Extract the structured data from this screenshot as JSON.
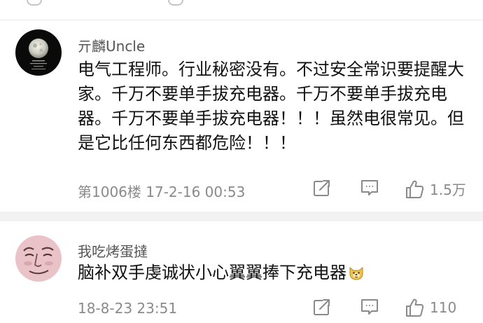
{
  "comments": [
    {
      "username": "亓麟Uncle",
      "text": "电气工程师。行业秘密没有。不过安全常识要提醒大家。千万不要单手拔充电器。千万不要单手拔充电器。千万不要单手拔充电器！！！虽然电很常见。但是它比任何东西都危险！！！",
      "meta": "第1006楼  17-2-16 00:53",
      "likes": "1.5万",
      "avatar_icon": "moon-icon"
    },
    {
      "username": "我吃烤蛋撻",
      "text": "脑补双手虔诚状小心翼翼捧下充电器",
      "emoji_icon": "doge-emoji-icon",
      "meta": "18-8-23 23:51",
      "likes": "110",
      "avatar_icon": "face-icon"
    }
  ],
  "colors": {
    "meta_text": "#8a8a8a",
    "divider": "#f2f2f2"
  }
}
